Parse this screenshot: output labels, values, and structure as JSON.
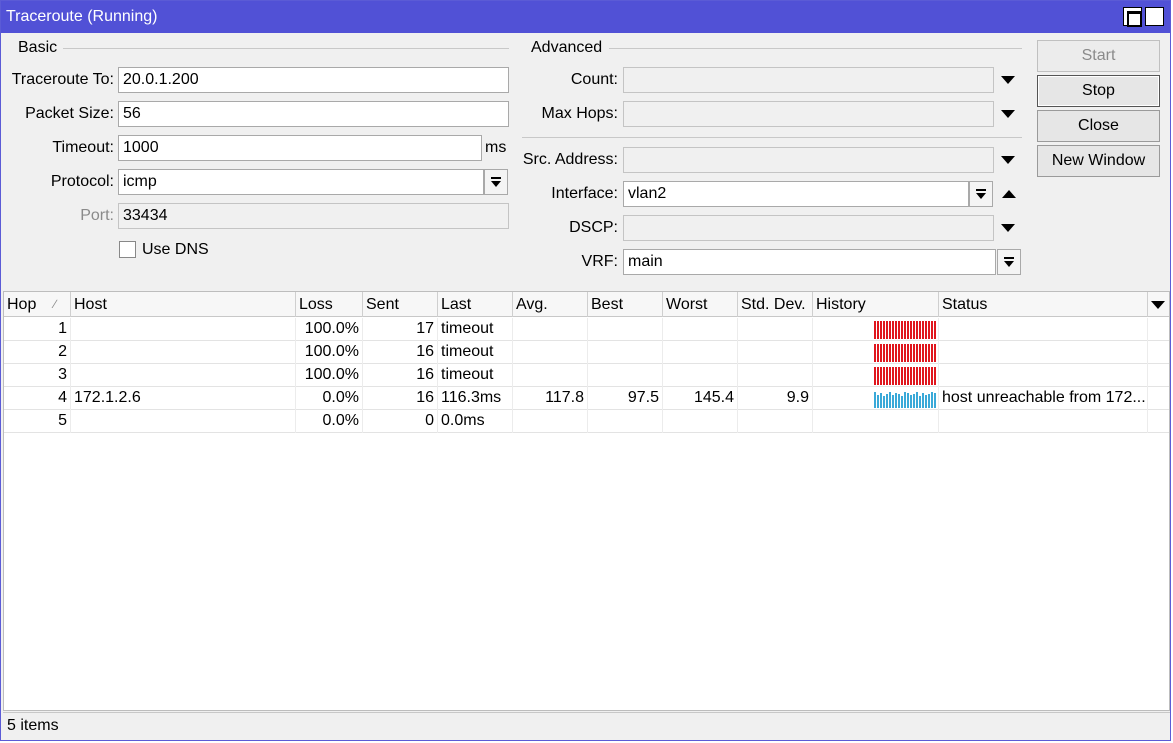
{
  "window": {
    "title": "Traceroute (Running)"
  },
  "basic": {
    "group_label": "Basic",
    "traceroute_to_label": "Traceroute To:",
    "traceroute_to_value": "20.0.1.200",
    "packet_size_label": "Packet Size:",
    "packet_size_value": "56",
    "timeout_label": "Timeout:",
    "timeout_value": "1000",
    "timeout_unit": "ms",
    "protocol_label": "Protocol:",
    "protocol_value": "icmp",
    "port_label": "Port:",
    "port_value": "33434",
    "use_dns_label": "Use DNS",
    "use_dns_checked": false
  },
  "advanced": {
    "group_label": "Advanced",
    "count_label": "Count:",
    "count_value": "",
    "max_hops_label": "Max Hops:",
    "max_hops_value": "",
    "src_address_label": "Src. Address:",
    "src_address_value": "",
    "interface_label": "Interface:",
    "interface_value": "vlan2",
    "dscp_label": "DSCP:",
    "dscp_value": "",
    "vrf_label": "VRF:",
    "vrf_value": "main"
  },
  "buttons": {
    "start": "Start",
    "stop": "Stop",
    "close": "Close",
    "new_window": "New Window"
  },
  "table": {
    "columns": [
      "Hop",
      "Host",
      "Loss",
      "Sent",
      "Last",
      "Avg.",
      "Best",
      "Worst",
      "Std. Dev.",
      "History",
      "Status"
    ],
    "rows": [
      {
        "hop": "1",
        "host": "",
        "loss": "100.0%",
        "sent": "17",
        "last": "timeout",
        "avg": "",
        "best": "",
        "worst": "",
        "std_dev": "",
        "history": "timeout",
        "status": ""
      },
      {
        "hop": "2",
        "host": "",
        "loss": "100.0%",
        "sent": "16",
        "last": "timeout",
        "avg": "",
        "best": "",
        "worst": "",
        "std_dev": "",
        "history": "timeout",
        "status": ""
      },
      {
        "hop": "3",
        "host": "",
        "loss": "100.0%",
        "sent": "16",
        "last": "timeout",
        "avg": "",
        "best": "",
        "worst": "",
        "std_dev": "",
        "history": "timeout",
        "status": ""
      },
      {
        "hop": "4",
        "host": "172.1.2.6",
        "loss": "0.0%",
        "sent": "16",
        "last": "116.3ms",
        "avg": "117.8",
        "best": "97.5",
        "worst": "145.4",
        "std_dev": "9.9",
        "history": "ok",
        "status": "host unreachable from 172..."
      },
      {
        "hop": "5",
        "host": "",
        "loss": "0.0%",
        "sent": "0",
        "last": "0.0ms",
        "avg": "",
        "best": "",
        "worst": "",
        "std_dev": "",
        "history": "none",
        "status": ""
      }
    ]
  },
  "colors": {
    "titlebar": "#5151d6",
    "history_timeout": "#e0161d",
    "history_ok": "#3aa9d8"
  },
  "status_bar": {
    "item_count": "5 items"
  }
}
